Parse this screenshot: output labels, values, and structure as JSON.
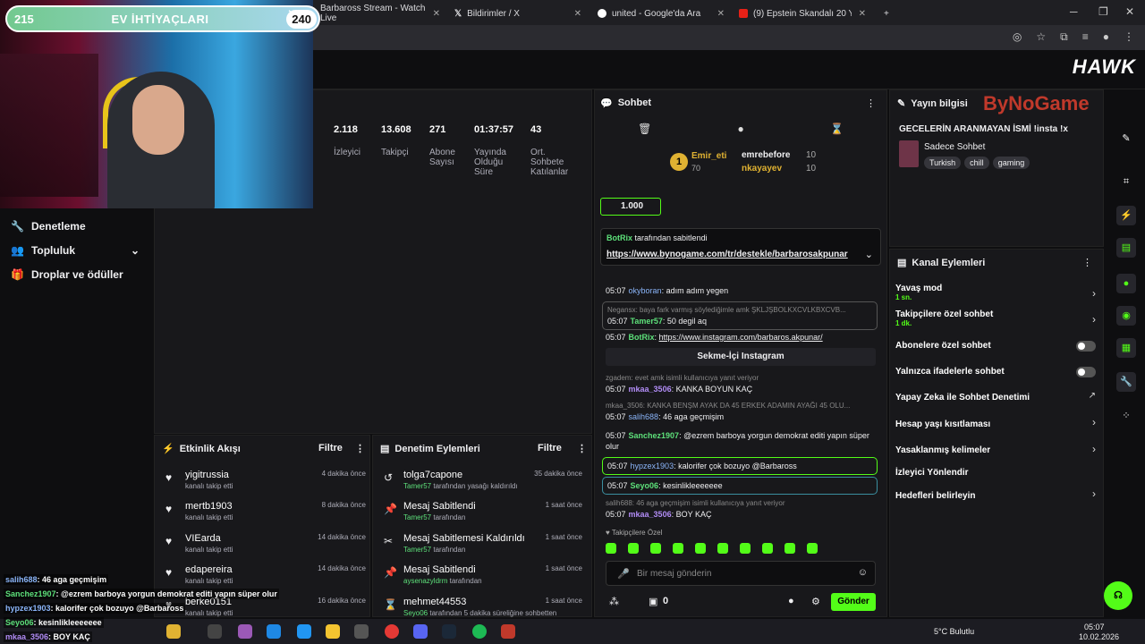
{
  "browser": {
    "tabs": [
      {
        "label": "Barbaross Stream - Watch Live"
      },
      {
        "label": "Bildirimler / X"
      },
      {
        "label": "united - Google'da Ara"
      },
      {
        "label": "(9) Epstein Skandalı 20 YIL BO"
      }
    ]
  },
  "goal": {
    "current": "215",
    "title": "EV İHTİYAÇLARI",
    "target": "240"
  },
  "brand": {
    "logo": "HAWK",
    "sponsor": "ByNoGame"
  },
  "leftnav": {
    "items": [
      {
        "label": "Denetleme"
      },
      {
        "label": "Topluluk"
      },
      {
        "label": "Droplar ve ödüller"
      }
    ]
  },
  "stats": [
    {
      "value": "2.118",
      "label": "İzleyici"
    },
    {
      "value": "13.608",
      "label": "Takipçi"
    },
    {
      "value": "271",
      "label": "Abone Sayısı"
    },
    {
      "value": "01:37:57",
      "label": "Yayında Olduğu Süre"
    },
    {
      "value": "43",
      "label": "Ort. Sohbete Katılanlar"
    }
  ],
  "activity": {
    "title": "Etkinlik Akışı",
    "filter": "Filtre",
    "rows": [
      {
        "name": "yigitrussia",
        "sub": "kanalı takip etti",
        "time": "4 dakika önce"
      },
      {
        "name": "mertb1903",
        "sub": "kanalı takip etti",
        "time": "8 dakika önce"
      },
      {
        "name": "VIEarda",
        "sub": "kanalı takip etti",
        "time": "14 dakika önce"
      },
      {
        "name": "edapereira",
        "sub": "kanalı takip etti",
        "time": "14 dakika önce"
      },
      {
        "name": "berke0151",
        "sub": "kanalı takip etti",
        "time": "16 dakika önce"
      }
    ]
  },
  "modlog": {
    "title": "Denetim Eylemleri",
    "filter": "Filtre",
    "rows": [
      {
        "name": "tolga7capone",
        "actor": "Tamer57",
        "sub": "tarafından yasağı kaldırıldı",
        "time": "35 dakika önce"
      },
      {
        "name": "Mesaj Sabitlendi",
        "actor": "Tamer57",
        "sub": "tarafından",
        "time": "1 saat önce"
      },
      {
        "name": "Mesaj Sabitlemesi Kaldırıldı",
        "actor": "Tamer57",
        "sub": "tarafından",
        "time": "1 saat önce"
      },
      {
        "name": "Mesaj Sabitlendi",
        "actor": "aysenazyldrm",
        "sub": "tarafından",
        "time": "1 saat önce"
      },
      {
        "name": "mehmet44553",
        "actor": "Seyo06",
        "sub": "tarafından 5 dakika süreliğine sohbetten",
        "time": "1 saat önce"
      }
    ]
  },
  "chat": {
    "title": "Sohbet",
    "leader": {
      "rank": "1",
      "name": "Emir_eti",
      "points": "70",
      "second": "emrebefore",
      "second_pts": "10",
      "third": "nkayayev",
      "third_pts": "10"
    },
    "gift_count": "1.000",
    "pinned": {
      "by": "BotRix",
      "by_suffix": "tarafından sabitlendi",
      "link": "https://www.bynogame.com/tr/destekle/barbarosakpunar"
    },
    "messages": [
      {
        "time": "05:07",
        "user": "okyboran",
        "text": "adım adım yegen",
        "reply": ""
      },
      {
        "time": "05:07",
        "user": "Tamer57",
        "text": "50 degil aq",
        "reply": "Negansx: baya fark varmış söylediğimle amk ŞKLJŞBOLKXCVLKBXCVB..."
      },
      {
        "time": "05:07",
        "user": "BotRix",
        "text": "https://www.instagram.com/barbaros.akpunar/",
        "reply": ""
      },
      {
        "time": "05:07",
        "user": "mkaa_3506",
        "text": "KANKA BOYUN KAÇ",
        "reply": "zgadem: evet amk isimli kullanıcıya yanıt veriyor"
      },
      {
        "time": "05:07",
        "user": "salih688",
        "text": "46 aga geçmişim",
        "reply": "mkaa_3506: KANKA BENŞM AYAK DA 45 ERKEK ADAMIN AYAĞI 45 OLU..."
      },
      {
        "time": "05:07",
        "user": "Sanchez1907",
        "text": "@ezrem barboya yorgun demokrat editi yapın süper olur",
        "reply": ""
      },
      {
        "time": "05:07",
        "user": "hypzex1903",
        "text": "kalorifer çok bozuyo @Barbaross",
        "reply": ""
      },
      {
        "time": "05:07",
        "user": "Seyo06",
        "text": "kesinlikleeeeeee",
        "reply": ""
      },
      {
        "time": "05:07",
        "user": "mkaa_3506",
        "text": "BOY KAÇ",
        "reply": "salih688: 46 aga geçmişim isimli kullanıcıya yanıt veriyor"
      }
    ],
    "insta_button": "Sekme-İçi Instagram",
    "followers_only": "Takipçilere Özel",
    "input_placeholder": "Bir mesaj gönderin",
    "points": "0",
    "send": "Gönder"
  },
  "stream_info": {
    "title": "Yayın bilgisi",
    "stream_title": "GECELERİN ARANMAYAN İSMİ !insta !x",
    "category": "Sadece Sohbet",
    "tags": [
      "Turkish",
      "chill",
      "gaming"
    ]
  },
  "channel_actions": {
    "title": "Kanal Eylemleri",
    "items": [
      {
        "label": "Yavaş mod",
        "sub": "1 sn."
      },
      {
        "label": "Takipçilere özel sohbet",
        "sub": "1 dk."
      },
      {
        "label": "Abonelere özel sohbet",
        "sub": ""
      },
      {
        "label": "Yalnızca ifadelerle sohbet",
        "sub": ""
      },
      {
        "label": "Yapay Zeka ile Sohbet Denetimi",
        "sub": ""
      },
      {
        "label": "Hesap yaşı kısıtlaması",
        "sub": ""
      },
      {
        "label": "Yasaklanmış kelimeler",
        "sub": ""
      },
      {
        "label": "İzleyici Yönlendir",
        "sub": ""
      },
      {
        "label": "Hedefleri belirleyin",
        "sub": ""
      }
    ]
  },
  "overlay_chat": [
    {
      "user": "salih688",
      "text": ": 46 aga geçmişim"
    },
    {
      "user": "Sanchez1907",
      "text": ": @ezrem barboya yorgun demokrat editi yapın süper olur"
    },
    {
      "user": "hypzex1903",
      "text": ": kalorifer çok bozuyo @Barbaross"
    },
    {
      "user": "Seyo06",
      "text": ": kesinlikleeeeeee"
    },
    {
      "user": "mkaa_3506",
      "text": ": BOY KAÇ"
    }
  ],
  "taskbar": {
    "weather": "5°C Bulutlu",
    "time": "05:07",
    "date": "10.02.2026"
  },
  "colors": {
    "accent": "#53fc18",
    "bg": "#0e0e10",
    "panel": "#18181b"
  }
}
